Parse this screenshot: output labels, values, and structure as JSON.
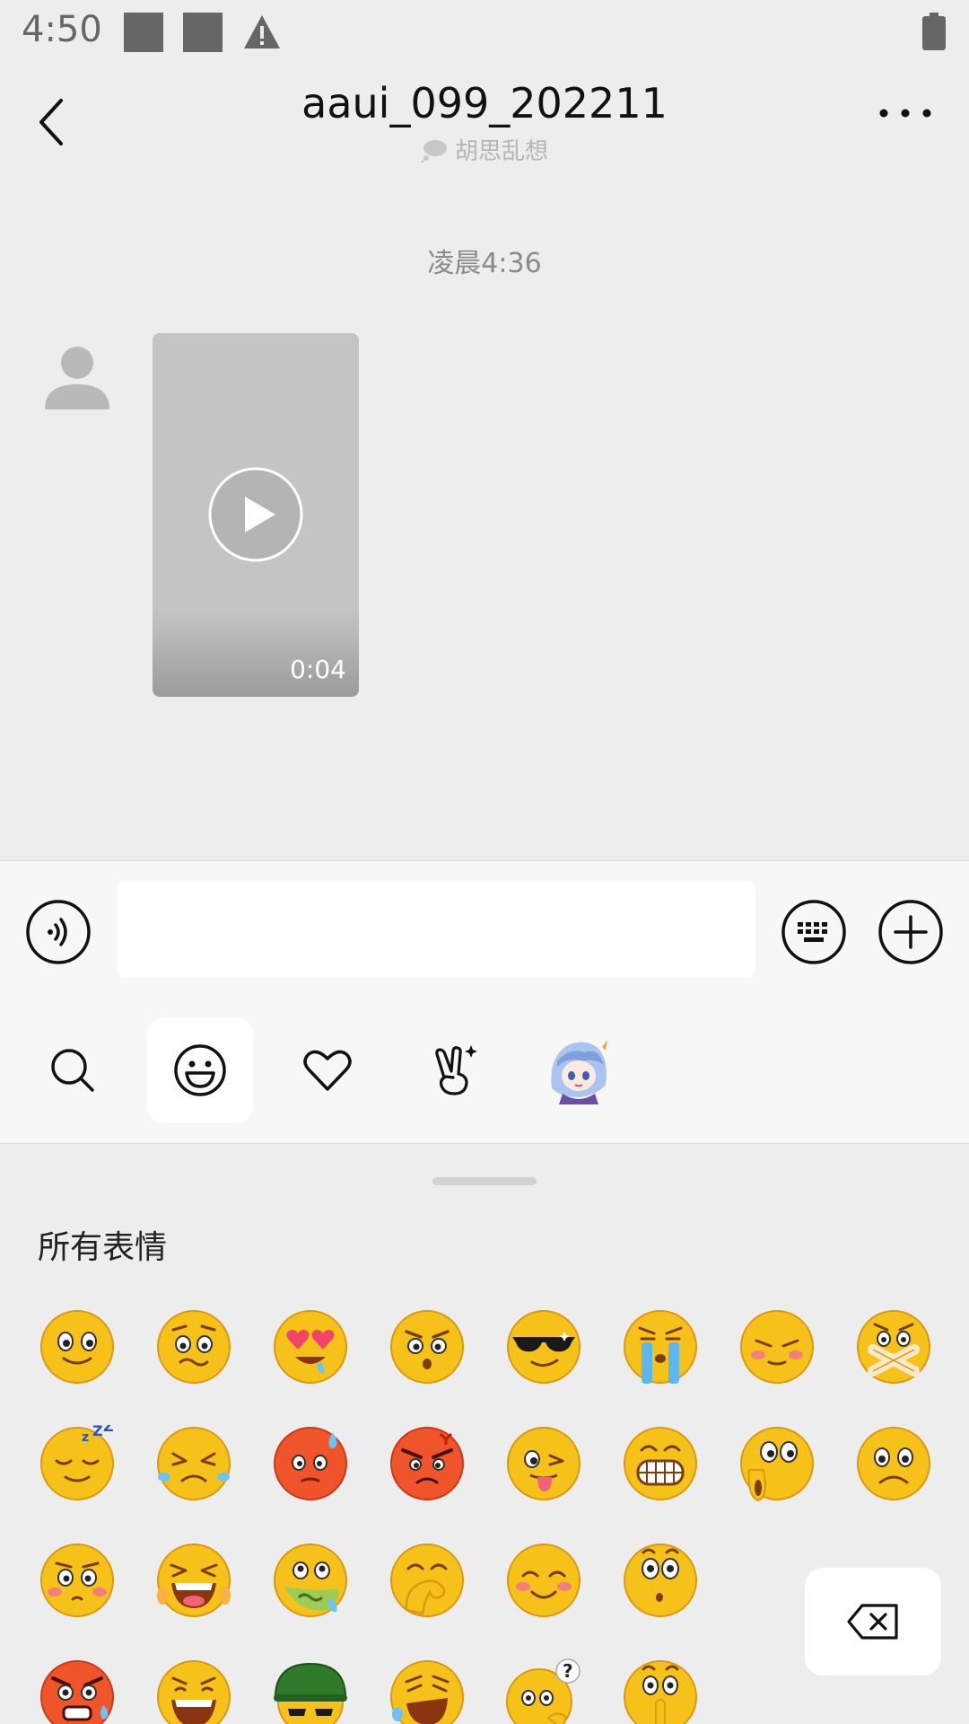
{
  "status_bar": {
    "time": "4:50"
  },
  "header": {
    "title": "aaui_099_202211",
    "subtitle": "胡思乱想"
  },
  "messages": {
    "timestamp": "凌晨4:36",
    "video_duration": "0:04"
  },
  "input": {
    "placeholder": ""
  },
  "sticker_tabs": [
    "search-icon",
    "emoji-face-icon",
    "heart-icon",
    "victory-hand-icon",
    "anime-sticker-icon"
  ],
  "emoji_panel": {
    "section_title": "所有表情"
  },
  "colors": {
    "emoji_yellow": "#f6c21a",
    "emoji_red": "#f0542a",
    "background": "#ededed",
    "accent_dark": "#222222"
  }
}
